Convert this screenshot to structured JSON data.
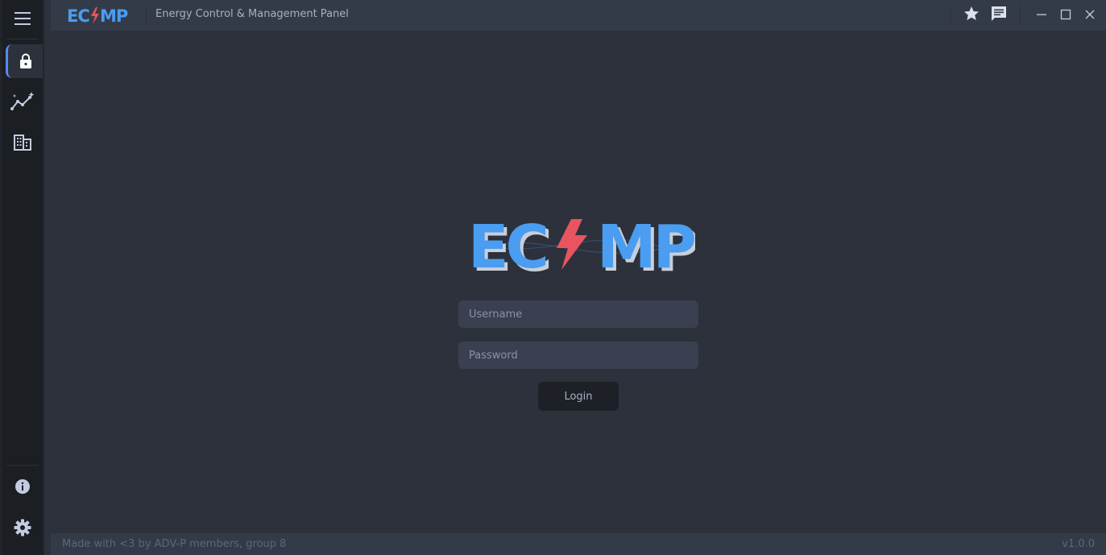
{
  "app": {
    "logo_text": "ECMP",
    "title": "Energy Control & Management Panel"
  },
  "sidebar": {
    "items": [
      {
        "icon": "menu-icon"
      },
      {
        "icon": "lock-icon",
        "active": true
      },
      {
        "icon": "chart-line-icon"
      },
      {
        "icon": "building-icon"
      }
    ],
    "bottom_items": [
      {
        "icon": "info-icon"
      },
      {
        "icon": "gear-icon"
      }
    ]
  },
  "titlebar": {
    "icons": [
      "star-icon",
      "chat-icon",
      "minimize-icon",
      "maximize-icon",
      "close-icon"
    ]
  },
  "login": {
    "username_placeholder": "Username",
    "username_value": "",
    "password_placeholder": "Password",
    "password_value": "",
    "button_label": "Login"
  },
  "footer": {
    "credit": "Made with <3 by ADV-P members, group 8",
    "version": "v1.0.0"
  },
  "colors": {
    "accent_blue": "#4a9df0",
    "accent_red": "#e8555f",
    "background": "#2c313c",
    "sidebar": "#1b1e23",
    "titlebar": "#343b48"
  }
}
